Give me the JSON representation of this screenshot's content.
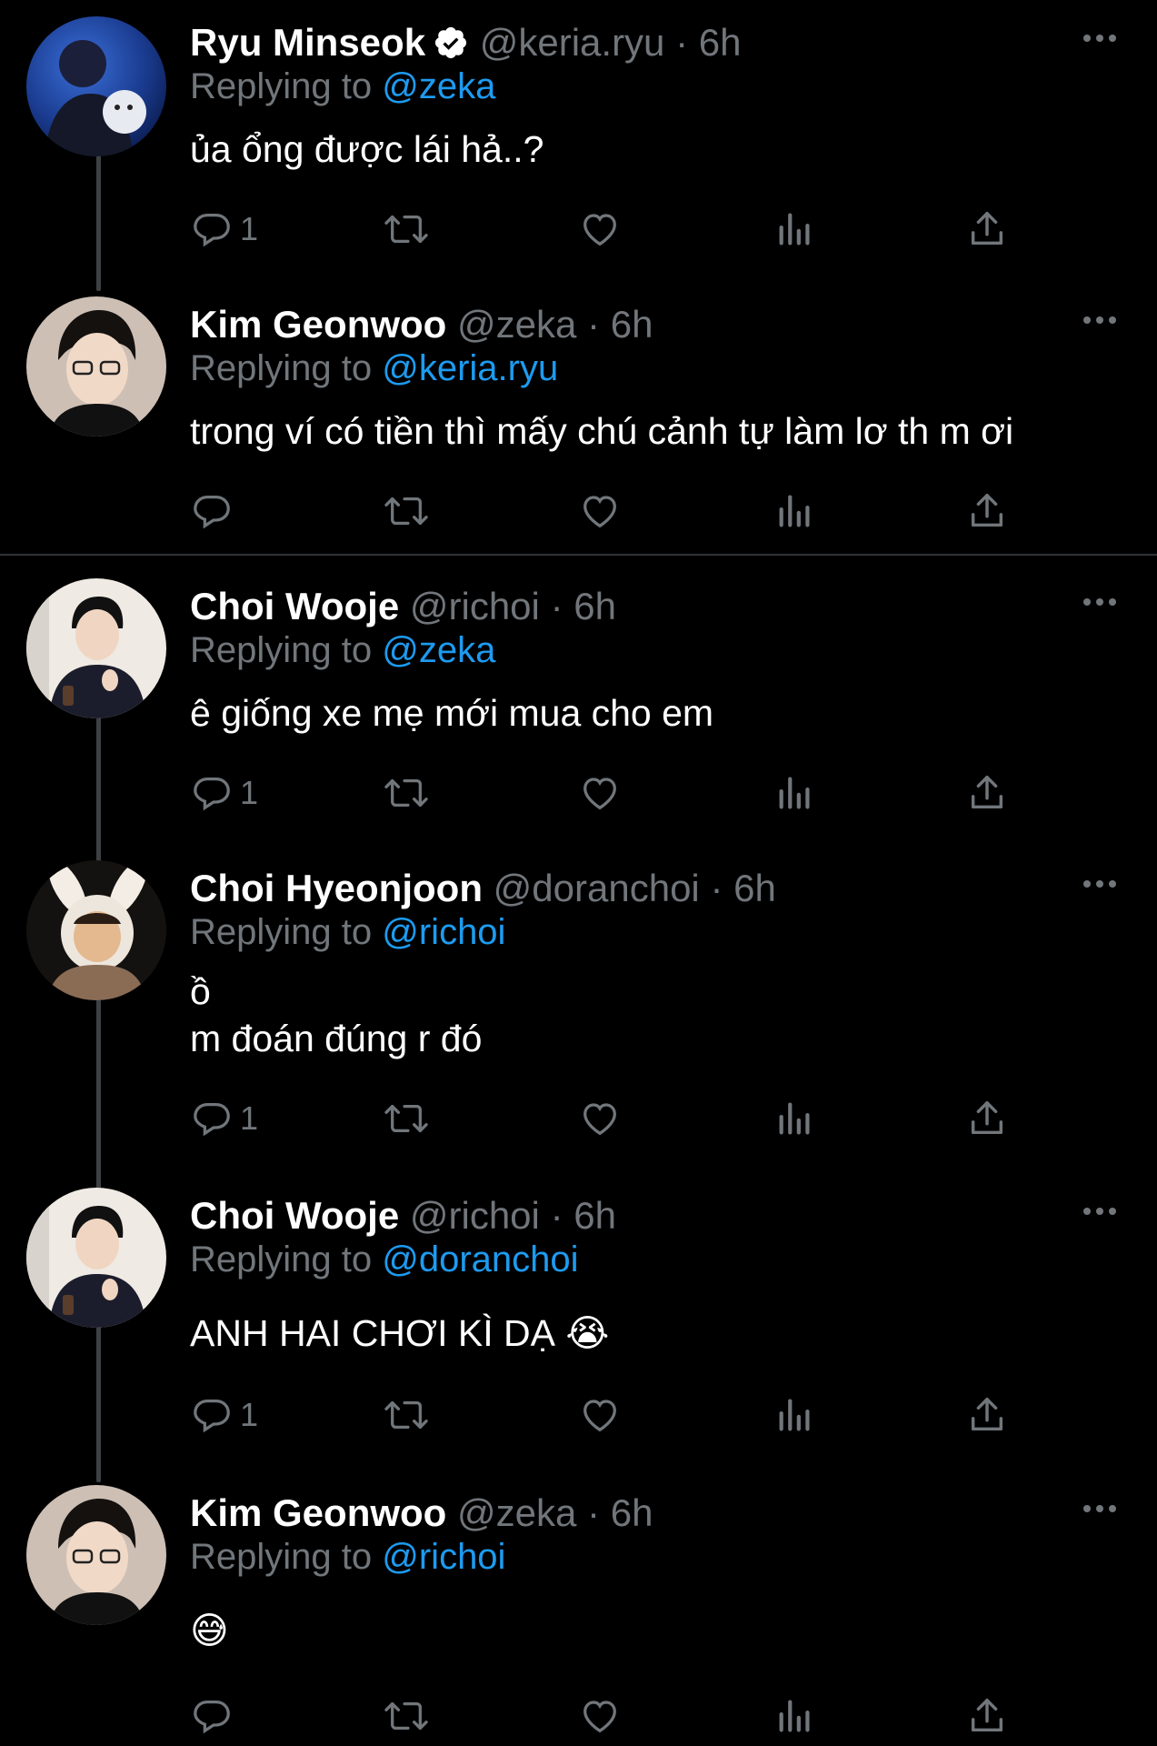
{
  "ui": {
    "reply_prefix": "Replying to",
    "dot": "·",
    "colors": {
      "background": "#000000",
      "name": "#ffffff",
      "muted": "#71767b",
      "mention": "#1d9bf0",
      "thread_line": "#3e4144"
    }
  },
  "tweets": [
    {
      "name": "Ryu Minseok",
      "verified": true,
      "handle": "@keria.ryu",
      "time": "6h",
      "replying_to": "@zeka",
      "text": "ủa ổng được lái hả..?",
      "reply_count": "1",
      "avatar": "avatar-blue-night-with-dog"
    },
    {
      "name": "Kim Geonwoo",
      "verified": false,
      "handle": "@zeka",
      "time": "6h",
      "replying_to": "@keria.ryu",
      "text": "trong ví có tiền thì mấy chú cảnh tự làm lơ th m ơi",
      "reply_count": "",
      "avatar": "avatar-glasses-dark"
    },
    {
      "name": "Choi Wooje",
      "verified": false,
      "handle": "@richoi",
      "time": "6h",
      "replying_to": "@zeka",
      "text": "ê giống xe mẹ mới mua cho em",
      "reply_count": "1",
      "avatar": "avatar-thumbs-up-light"
    },
    {
      "name": "Choi Hyeonjoon",
      "verified": false,
      "handle": "@doranchoi",
      "time": "6h",
      "replying_to": "@richoi",
      "text": "ồ\nm đoán đúng r đó",
      "reply_count": "1",
      "avatar": "avatar-bunny-ears"
    },
    {
      "name": "Choi Wooje",
      "verified": false,
      "handle": "@richoi",
      "time": "6h",
      "replying_to": "@doranchoi",
      "text": "ANH HAI CHƠI KÌ DẠ 😭",
      "reply_count": "1",
      "avatar": "avatar-thumbs-up-light"
    },
    {
      "name": "Kim Geonwoo",
      "verified": false,
      "handle": "@zeka",
      "time": "6h",
      "replying_to": "@richoi",
      "text": "😅",
      "reply_count": "",
      "avatar": "avatar-glasses-dark"
    }
  ],
  "icons": {
    "reply": "reply-icon",
    "retweet": "retweet-icon",
    "like": "heart-icon",
    "views": "views-icon",
    "share": "share-icon",
    "more": "more-icon",
    "verified": "verified-badge-icon"
  }
}
